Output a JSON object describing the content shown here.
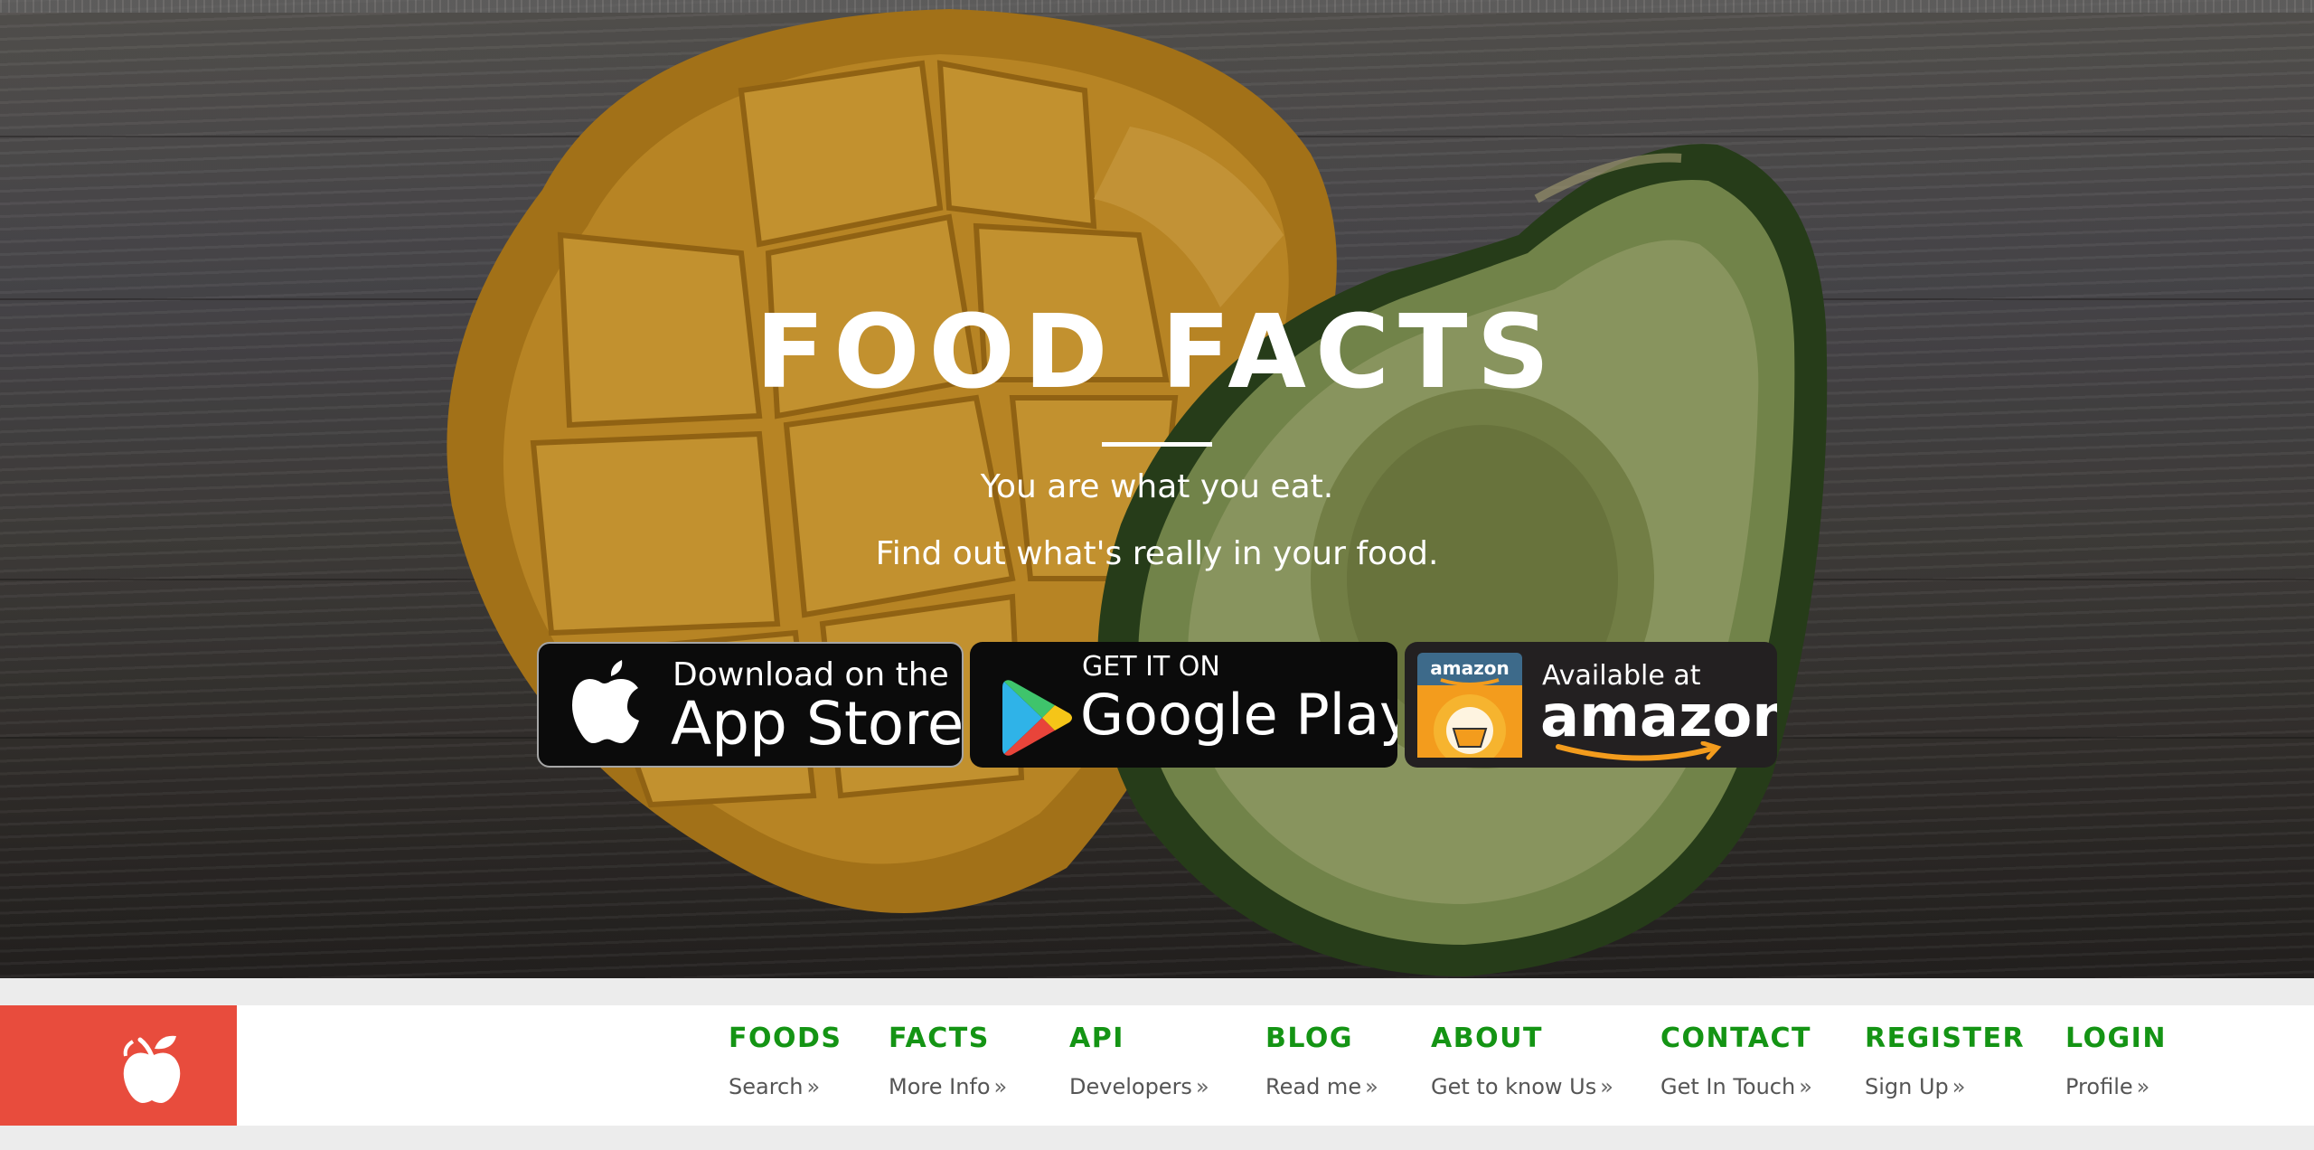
{
  "hero": {
    "title": "FOOD FACTS",
    "tagline_1": "You are what you eat.",
    "tagline_2": "Find out what's really in your food."
  },
  "badges": {
    "app_store": {
      "small": "Download on the",
      "big": "App Store",
      "icon": "apple-icon"
    },
    "google_play": {
      "small": "GET IT ON",
      "big": "Google Play",
      "icon": "google-play-icon"
    },
    "amazon": {
      "small": "Available at",
      "big": "amazon",
      "icon_text": "amazon",
      "icon": "amazon-appstore-icon"
    }
  },
  "nav": {
    "logo": "apple-logo-icon",
    "chevron": "»",
    "items": [
      {
        "title": "FOODS",
        "sub": "Search"
      },
      {
        "title": "FACTS",
        "sub": "More Info"
      },
      {
        "title": "API",
        "sub": "Developers"
      },
      {
        "title": "BLOG",
        "sub": "Read me"
      },
      {
        "title": "ABOUT",
        "sub": "Get to know Us"
      },
      {
        "title": "CONTACT",
        "sub": "Get In Touch"
      },
      {
        "title": "REGISTER",
        "sub": "Sign Up"
      },
      {
        "title": "LOGIN",
        "sub": "Profile"
      }
    ]
  },
  "colors": {
    "brand_red": "#e84c3d",
    "nav_green": "#149414",
    "nav_sub": "#555555"
  }
}
